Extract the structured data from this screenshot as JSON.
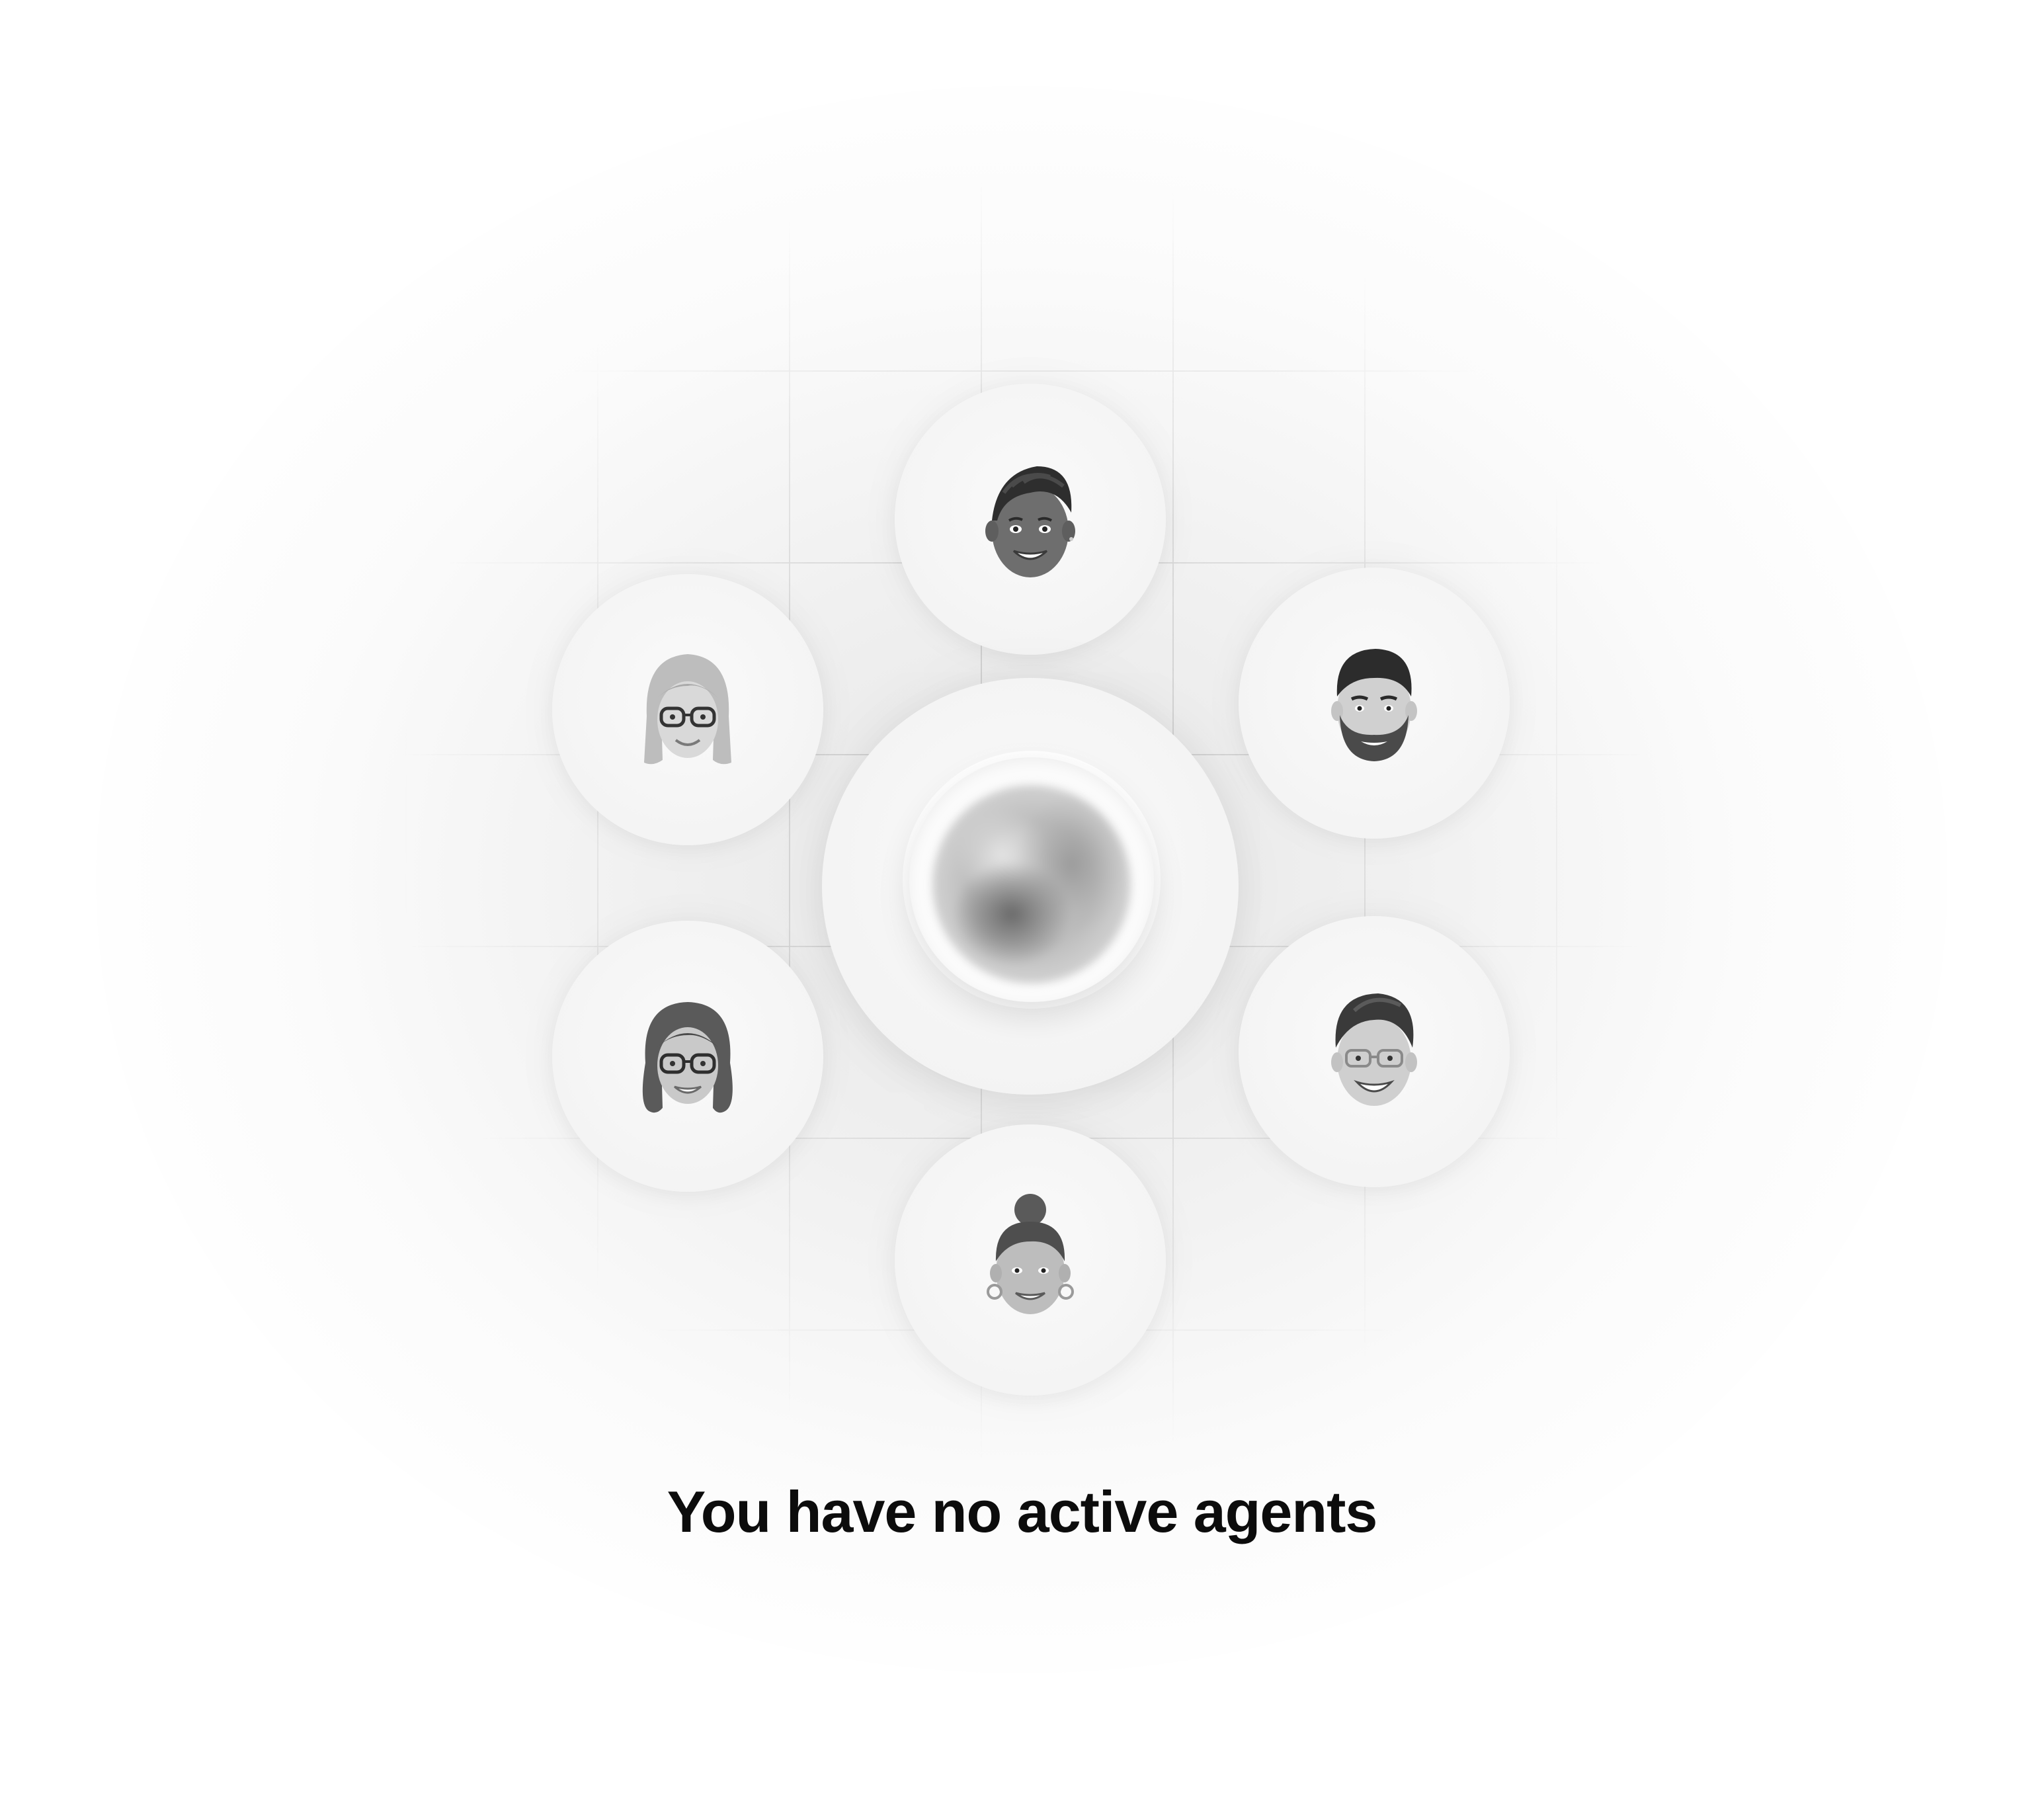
{
  "empty_state": {
    "message": "You have no active agents",
    "center_icon": "agent-orb-icon",
    "avatars": [
      {
        "id": "top",
        "icon": "memoji-short-hair-icon"
      },
      {
        "id": "upper-left",
        "icon": "memoji-long-hair-glasses-icon"
      },
      {
        "id": "upper-right",
        "icon": "memoji-bearded-man-icon"
      },
      {
        "id": "lower-left",
        "icon": "memoji-woman-glasses-icon"
      },
      {
        "id": "lower-right",
        "icon": "memoji-man-glasses-icon"
      },
      {
        "id": "bottom",
        "icon": "memoji-hair-bun-icon"
      }
    ]
  }
}
